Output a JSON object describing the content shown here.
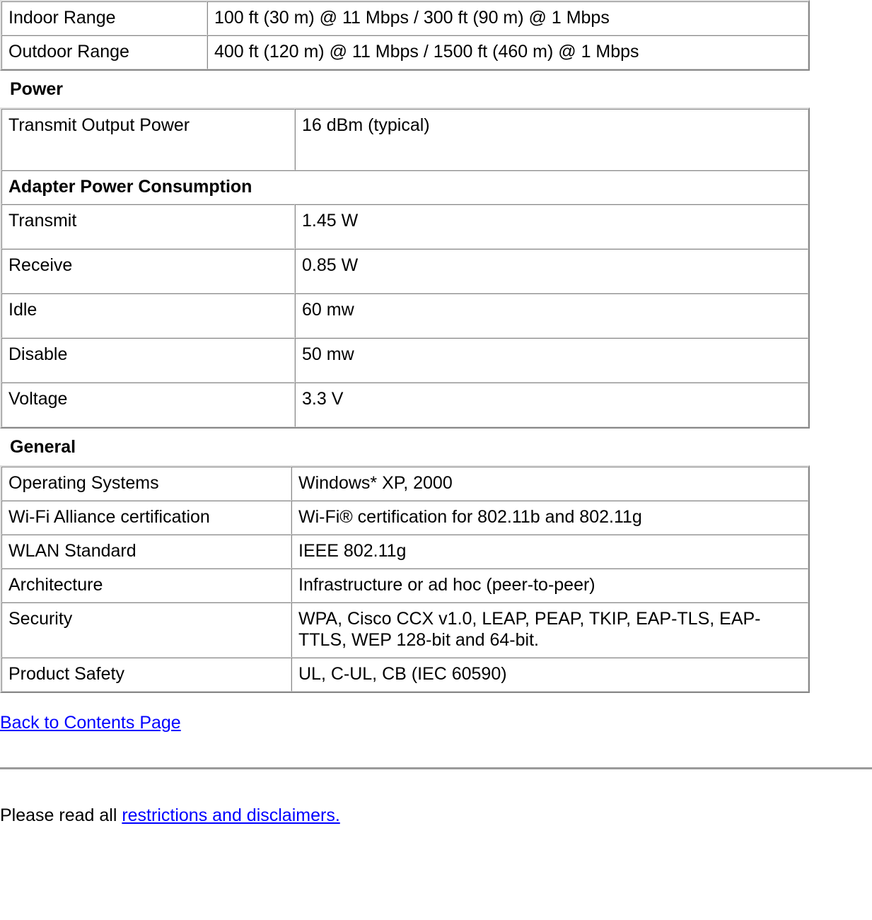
{
  "document": {
    "tables": [
      {
        "name": "range-table",
        "rows": [
          {
            "label": "Indoor Range",
            "value": "100 ft (30 m) @ 11 Mbps / 300 ft (90 m) @ 1 Mbps"
          },
          {
            "label": "Outdoor Range",
            "value": "400 ft (120 m) @ 11 Mbps / 1500 ft (460 m) @ 1 Mbps"
          }
        ]
      }
    ],
    "power_section": {
      "heading": "Power",
      "transmit_output_power_label": "Transmit Output Power",
      "transmit_output_power_value": "16 dBm (typical)",
      "adapter_power_consumption_heading": "Adapter Power Consumption",
      "consumption_rows": [
        {
          "label": "Transmit",
          "value": "1.45 W"
        },
        {
          "label": "Receive",
          "value": "0.85 W"
        },
        {
          "label": "Idle",
          "value": "60 mw"
        },
        {
          "label": "Disable",
          "value": "50 mw"
        }
      ],
      "voltage_label": "Voltage",
      "voltage_value": "3.3 V"
    },
    "general_section": {
      "heading": "General",
      "rows": [
        {
          "label": "Operating Systems",
          "value": "Windows* XP, 2000"
        },
        {
          "label": "Wi-Fi Alliance certification",
          "value": "Wi-Fi® certification for 802.11b and 802.11g"
        },
        {
          "label": "WLAN Standard",
          "value": "IEEE 802.11g"
        },
        {
          "label": "Architecture",
          "value": "Infrastructure or ad hoc (peer-to-peer)"
        },
        {
          "label": "Security",
          "value": "WPA, Cisco CCX v1.0, LEAP, PEAP, TKIP, EAP-TLS, EAP-TTLS, WEP 128-bit and 64-bit."
        },
        {
          "label": "Product Safety",
          "value": "UL, C-UL, CB (IEC 60590)"
        }
      ]
    },
    "footer": {
      "back_link": "Back to Contents Page",
      "disclaimer_prefix": "Please read all ",
      "disclaimer_link": "restrictions and disclaimers."
    },
    "colors": {
      "link": "#0000ff",
      "text": "#000000",
      "table_border": "#dcdcdc",
      "rule": "#9a9a9a",
      "background": "#ffffff"
    }
  }
}
